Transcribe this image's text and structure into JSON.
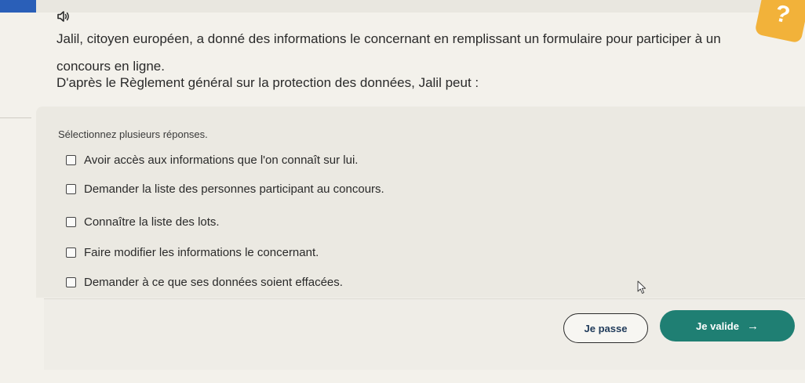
{
  "progress": {
    "fraction": 0.045
  },
  "icons": {
    "speaker": "speaker-icon",
    "help": "help-icon",
    "arrow": "arrow-right-icon",
    "cursor": "mouse-cursor-icon"
  },
  "colors": {
    "progress": "#2a5fb8",
    "help": "#f2b23a",
    "validate": "#1f7f73"
  },
  "help": {
    "label": "?"
  },
  "question": {
    "text": "Jalil, citoyen européen, a donné des informations le concernant en remplissant un formulaire pour participer à un concours en ligne.",
    "prompt": "D'après le Règlement général sur la protection des données, Jalil peut :"
  },
  "answers": {
    "instruction": "Sélectionnez plusieurs réponses.",
    "options": [
      {
        "label": "Avoir accès aux informations que l'on connaît sur lui.",
        "checked": false
      },
      {
        "label": "Demander la liste des personnes participant au concours.",
        "checked": false
      },
      {
        "label": "Connaître la liste des lots.",
        "checked": false
      },
      {
        "label": "Faire modifier les informations le concernant.",
        "checked": false
      },
      {
        "label": "Demander à ce que ses données soient effacées.",
        "checked": false
      }
    ]
  },
  "footer": {
    "skip_label": "Je passe",
    "validate_label": "Je valide",
    "arrow_glyph": "→"
  }
}
